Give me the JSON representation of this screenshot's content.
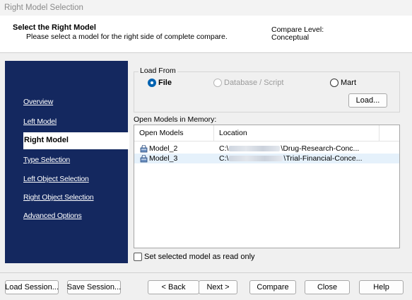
{
  "window": {
    "title": "Right Model Selection"
  },
  "header": {
    "title": "Select the Right Model",
    "subtitle": "Please select a model for the right side of complete compare.",
    "compare_level_label": "Compare Level:",
    "compare_level_value": "Conceptual"
  },
  "nav": {
    "active_index": 2,
    "items": [
      {
        "label": "Overview"
      },
      {
        "label": "Left Model"
      },
      {
        "label": "Right Model"
      },
      {
        "label": "Type Selection"
      },
      {
        "label": "Left Object Selection"
      },
      {
        "label": "Right Object Selection"
      },
      {
        "label": "Advanced Options"
      }
    ],
    "background_color": "#14285f"
  },
  "load_from": {
    "legend": "Load From",
    "selected": "File",
    "options": [
      {
        "label": "File",
        "checked": true,
        "enabled": true
      },
      {
        "label": "Database / Script",
        "checked": false,
        "enabled": false
      },
      {
        "label": "Mart",
        "checked": false,
        "enabled": true
      }
    ],
    "load_button": "Load..."
  },
  "open_models": {
    "label": "Open Models in Memory:",
    "columns": [
      "Open Models",
      "Location"
    ],
    "rows": [
      {
        "name": "Model_2",
        "location_prefix": "C:\\",
        "location_suffix": "\\Drug-Research-Conc...",
        "selected": false
      },
      {
        "name": "Model_3",
        "location_prefix": "C:\\",
        "location_suffix": "\\Trial-Financial-Conce...",
        "selected": true
      }
    ]
  },
  "read_only_checkbox": {
    "label": "Set selected model as read only",
    "checked": false
  },
  "footer": {
    "load_session": "Load Session...",
    "save_session": "Save Session...",
    "back": "< Back",
    "next": "Next >",
    "compare": "Compare",
    "close": "Close",
    "help": "Help"
  },
  "icons": {
    "model": "database-model-icon"
  },
  "colors": {
    "accent": "#0063b1",
    "selection": "#e5f1fb"
  }
}
